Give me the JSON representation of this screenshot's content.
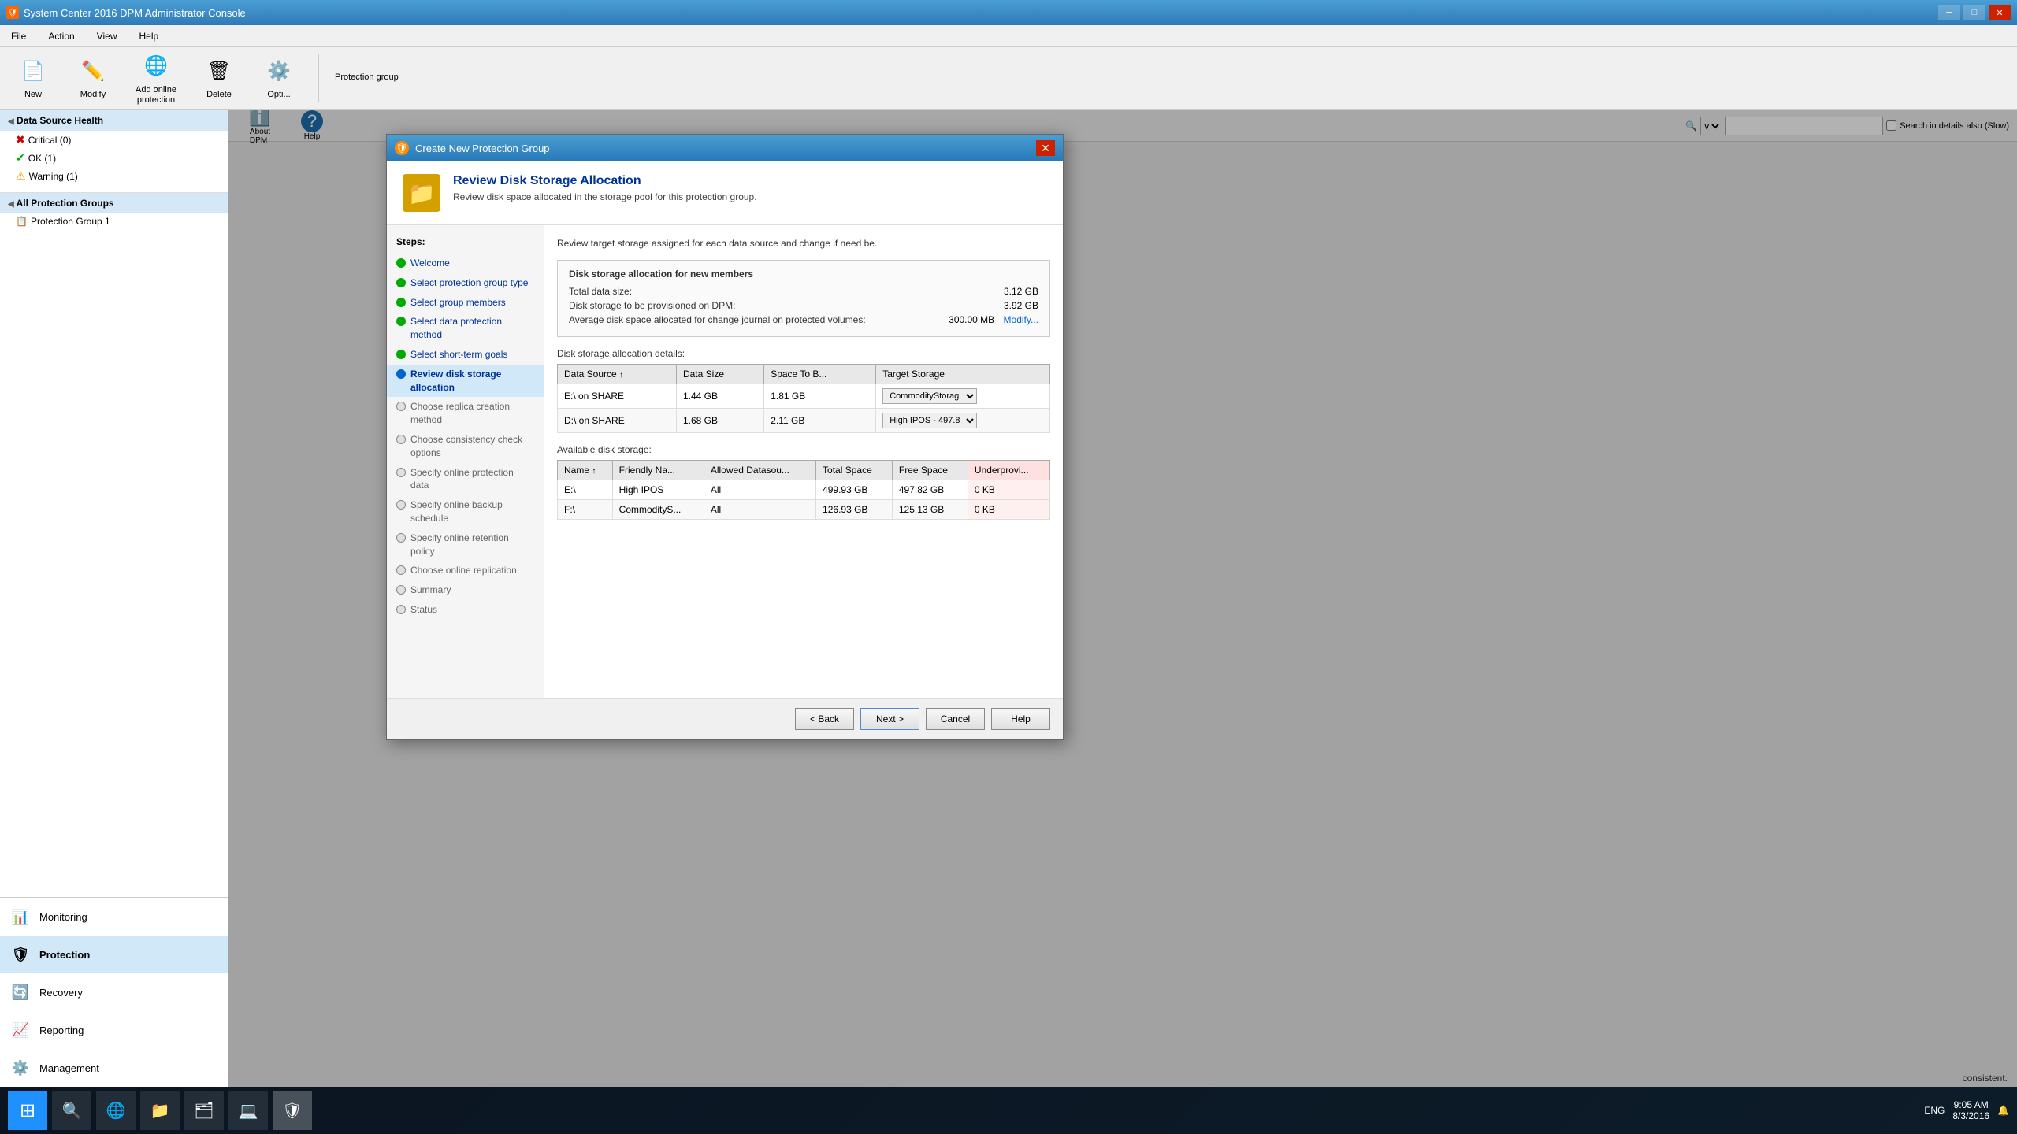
{
  "app": {
    "title": "System Center 2016 DPM Administrator Console",
    "icon": "🛡"
  },
  "menu": {
    "items": [
      "File",
      "Action",
      "View",
      "Help"
    ]
  },
  "toolbar": {
    "buttons": [
      {
        "id": "new",
        "label": "New",
        "icon": "📄"
      },
      {
        "id": "modify",
        "label": "Modify",
        "icon": "✏️"
      },
      {
        "id": "add-online-protection",
        "label": "Add online\nprotection",
        "icon": "🌐"
      },
      {
        "id": "delete",
        "label": "Delete",
        "icon": "🗑"
      },
      {
        "id": "optimize",
        "label": "Opti...",
        "icon": "⚙️"
      }
    ],
    "group_label": "Protection group"
  },
  "sidebar": {
    "data_source_health": {
      "title": "Data Source Health",
      "items": [
        {
          "id": "critical",
          "label": "Critical (0)",
          "status": "critical"
        },
        {
          "id": "ok",
          "label": "OK (1)",
          "status": "ok"
        },
        {
          "id": "warning",
          "label": "Warning (1)",
          "status": "warning"
        }
      ]
    },
    "all_protection_groups": {
      "title": "All Protection Groups",
      "items": [
        {
          "id": "pg1",
          "label": "Protection Group 1"
        }
      ]
    },
    "nav_items": [
      {
        "id": "monitoring",
        "label": "Monitoring",
        "icon": "📊"
      },
      {
        "id": "protection",
        "label": "Protection",
        "icon": "🛡",
        "active": true
      },
      {
        "id": "recovery",
        "label": "Recovery",
        "icon": "🔄"
      },
      {
        "id": "reporting",
        "label": "Reporting",
        "icon": "📈"
      },
      {
        "id": "management",
        "label": "Management",
        "icon": "⚙️"
      }
    ]
  },
  "right_toolbar": {
    "search_placeholder": "",
    "search_label": "Search in details also (Slow)"
  },
  "info_cards": [
    {
      "id": "about-dpm",
      "label": "About DPM",
      "icon": "ℹ️"
    },
    {
      "id": "help",
      "label": "Help",
      "icon": "?"
    }
  ],
  "dialog": {
    "title": "Create New Protection Group",
    "header": {
      "icon": "📁",
      "heading": "Review Disk Storage Allocation",
      "description": "Review disk space allocated in the storage pool for this protection group."
    },
    "steps_label": "Steps:",
    "steps": [
      {
        "id": "welcome",
        "label": "Welcome",
        "state": "complete"
      },
      {
        "id": "select-protection-group-type",
        "label": "Select protection group type",
        "state": "complete"
      },
      {
        "id": "select-group-members",
        "label": "Select group members",
        "state": "complete"
      },
      {
        "id": "select-data-protection-method",
        "label": "Select data protection method",
        "state": "complete"
      },
      {
        "id": "select-short-term-goals",
        "label": "Select short-term goals",
        "state": "complete"
      },
      {
        "id": "review-disk-storage-allocation",
        "label": "Review disk storage allocation",
        "state": "active"
      },
      {
        "id": "choose-replica-creation-method",
        "label": "Choose replica creation method",
        "state": "inactive"
      },
      {
        "id": "choose-consistency-check-options",
        "label": "Choose consistency check options",
        "state": "inactive"
      },
      {
        "id": "specify-online-protection-data",
        "label": "Specify online protection data",
        "state": "inactive"
      },
      {
        "id": "specify-online-backup-schedule",
        "label": "Specify online backup schedule",
        "state": "inactive"
      },
      {
        "id": "specify-online-retention-policy",
        "label": "Specify online retention policy",
        "state": "inactive"
      },
      {
        "id": "choose-online-replication",
        "label": "Choose online replication",
        "state": "inactive"
      },
      {
        "id": "summary",
        "label": "Summary",
        "state": "inactive"
      },
      {
        "id": "status",
        "label": "Status",
        "state": "inactive"
      }
    ],
    "content": {
      "intro": "Review target storage assigned for each data source and change if need be.",
      "allocation_section": {
        "title": "Disk storage allocation for new members",
        "total_data_size_label": "Total data size:",
        "total_data_size_value": "3.12 GB",
        "disk_storage_label": "Disk storage to be provisioned on DPM:",
        "disk_storage_value": "3.92 GB",
        "average_disk_label": "Average disk space allocated for change journal on protected volumes:",
        "average_disk_value": "300.00 MB",
        "modify_link": "Modify..."
      },
      "details_label": "Disk storage allocation details:",
      "details_table": {
        "columns": [
          "Data Source",
          "Data Size",
          "Space To B...",
          "Target Storage"
        ],
        "rows": [
          {
            "data_source": "E:\\ on  SHARE",
            "data_size": "1.44 GB",
            "space_to_b": "1.81 GB",
            "target_storage": "CommodityStorag...",
            "target_storage_options": [
              "CommodityStorag...",
              "High IPOS - 497.82..."
            ]
          },
          {
            "data_source": "D:\\ on  SHARE",
            "data_size": "1.68 GB",
            "space_to_b": "2.11 GB",
            "target_storage": "High IPOS - 497.82...",
            "target_storage_options": [
              "CommodityStorag...",
              "High IPOS - 497.82..."
            ]
          }
        ]
      },
      "available_label": "Available disk storage:",
      "available_table": {
        "columns": [
          "Name",
          "Friendly Na...",
          "Allowed Datasou...",
          "Total Space",
          "Free Space",
          "Underprovi..."
        ],
        "rows": [
          {
            "name": "E:\\",
            "friendly_name": "High IPOS",
            "allowed": "All",
            "total_space": "499.93 GB",
            "free_space": "497.82 GB",
            "underprovisioned": "0 KB",
            "highlight": false
          },
          {
            "name": "F:\\",
            "friendly_name": "CommodityS...",
            "allowed": "All",
            "total_space": "126.93 GB",
            "free_space": "125.13 GB",
            "underprovisioned": "0 KB",
            "highlight": false
          }
        ]
      }
    },
    "buttons": {
      "back": "< Back",
      "next": "Next >",
      "cancel": "Cancel",
      "help": "Help"
    }
  },
  "status_bar": {
    "message": "consistent."
  },
  "taskbar": {
    "time": "9:05 AM",
    "date": "8/3/2016",
    "language": "ENG"
  }
}
